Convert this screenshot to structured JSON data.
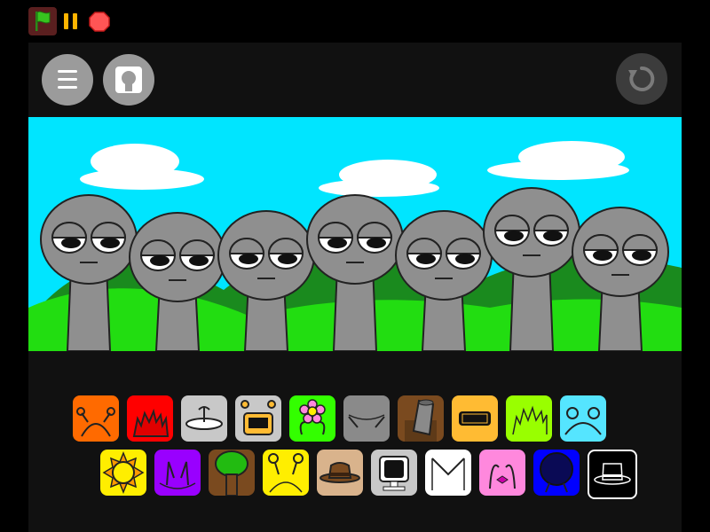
{
  "toolbar": {
    "controls": [
      {
        "name": "green-flag",
        "icon": "flag-icon"
      },
      {
        "name": "pause",
        "icon": "pause-icon"
      },
      {
        "name": "stop",
        "icon": "stop-icon"
      }
    ]
  },
  "header": {
    "buttons": [
      {
        "name": "menu",
        "icon": "hamburger-icon"
      },
      {
        "name": "character-mode",
        "icon": "portrait-icon"
      },
      {
        "name": "reset",
        "icon": "reset-icon"
      }
    ]
  },
  "scene": {
    "sky_color": "#00e5ff",
    "hill_color": "#22dd11",
    "character_color": "#8f8f8f",
    "character_count": 7
  },
  "palette": {
    "row1": [
      {
        "name": "orange-antenna",
        "color": "#ff6a00"
      },
      {
        "name": "red-spikes",
        "color": "#ff0000"
      },
      {
        "name": "grey-dish",
        "color": "#c8c8c8"
      },
      {
        "name": "grey-robot-visor",
        "color": "#c8c8c8"
      },
      {
        "name": "green-flower",
        "color": "#33ff00"
      },
      {
        "name": "grey-cat-ears",
        "color": "#8a8a8a"
      },
      {
        "name": "brown-bucket",
        "color": "#7a4a1f"
      },
      {
        "name": "yellow-visor",
        "color": "#ffbb33"
      },
      {
        "name": "lime-grass-hair",
        "color": "#99ff00"
      },
      {
        "name": "cyan-bear-ears",
        "color": "#55e5ff"
      }
    ],
    "row2": [
      {
        "name": "yellow-sun",
        "color": "#ffee00"
      },
      {
        "name": "purple-horns",
        "color": "#9900ff"
      },
      {
        "name": "brown-tree",
        "color": "#7a4a1f"
      },
      {
        "name": "yellow-antenna-eyes",
        "color": "#ffee00"
      },
      {
        "name": "tan-fedora",
        "color": "#d9b38c"
      },
      {
        "name": "grey-computer",
        "color": "#c8c8c8"
      },
      {
        "name": "white-envelope",
        "color": "#ffffff"
      },
      {
        "name": "pink-bow",
        "color": "#ff88dd"
      },
      {
        "name": "blue-afro",
        "color": "#0000ff"
      },
      {
        "name": "black-top-hat",
        "color": "#000000"
      }
    ]
  }
}
